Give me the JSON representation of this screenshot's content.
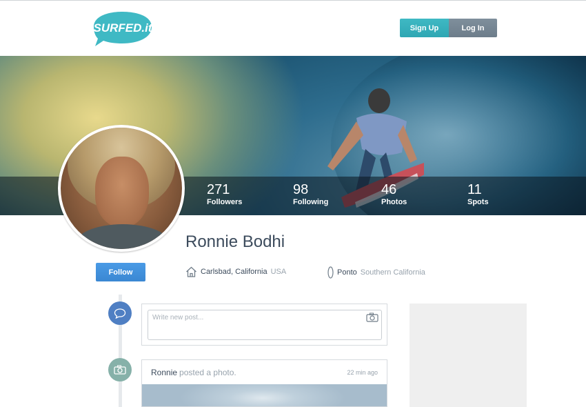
{
  "header": {
    "logo_text": "SURFED.it",
    "signup_label": "Sign Up",
    "login_label": "Log In"
  },
  "colors": {
    "brand_teal": "#3fb9c4",
    "login_gray": "#748491",
    "follow_blue": "#4292dc",
    "chat_icon_blue": "#4f7fc3",
    "camera_icon_green": "#86b1a9"
  },
  "stats": [
    {
      "value": "271",
      "label": "Followers"
    },
    {
      "value": "98",
      "label": "Following"
    },
    {
      "value": "46",
      "label": "Photos"
    },
    {
      "value": "11",
      "label": "Spots"
    }
  ],
  "profile": {
    "name": "Ronnie Bodhi",
    "follow_label": "Follow",
    "location_city": "Carlsbad, California",
    "location_country": "USA",
    "spot_name": "Ponto",
    "spot_region": "Southern California"
  },
  "composer": {
    "placeholder": "Write new post..."
  },
  "post": {
    "author": "Ronnie",
    "action": "posted a photo.",
    "time": "22 min ago"
  },
  "icons": {
    "home": "home-icon",
    "surfboard": "surfboard-icon",
    "chat": "chat-icon",
    "camera": "camera-icon"
  }
}
